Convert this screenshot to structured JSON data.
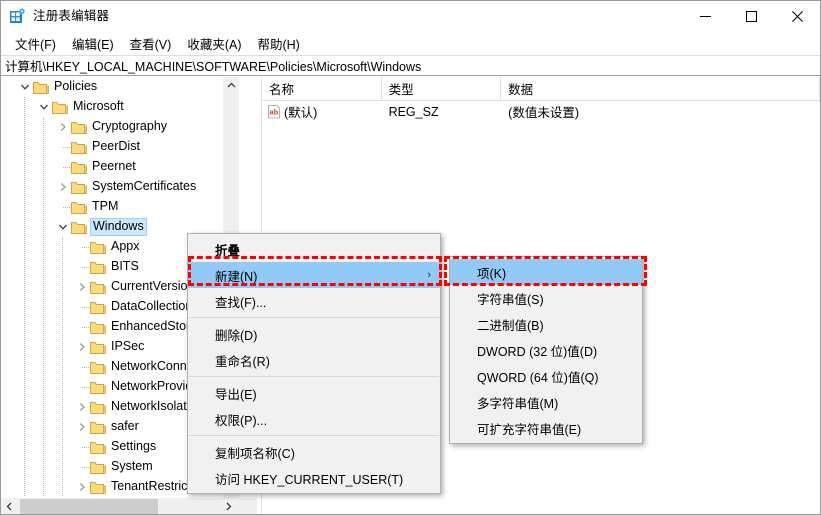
{
  "window": {
    "title": "注册表编辑器",
    "icon": "registry-editor-icon",
    "minimize": "—",
    "maximize": "□",
    "close": "✕"
  },
  "menubar": {
    "items": [
      {
        "label": "文件(F)",
        "name": "menu-file"
      },
      {
        "label": "编辑(E)",
        "name": "menu-edit"
      },
      {
        "label": "查看(V)",
        "name": "menu-view"
      },
      {
        "label": "收藏夹(A)",
        "name": "menu-favorites"
      },
      {
        "label": "帮助(H)",
        "name": "menu-help"
      }
    ]
  },
  "address": {
    "path": "计算机\\HKEY_LOCAL_MACHINE\\SOFTWARE\\Policies\\Microsoft\\Windows"
  },
  "tree": {
    "items": [
      {
        "label": "Policies",
        "depth": 1,
        "twisty": "expanded",
        "selected": false
      },
      {
        "label": "Microsoft",
        "depth": 2,
        "twisty": "expanded",
        "selected": false
      },
      {
        "label": "Cryptography",
        "depth": 3,
        "twisty": "collapsed",
        "selected": false
      },
      {
        "label": "PeerDist",
        "depth": 3,
        "twisty": "none",
        "selected": false
      },
      {
        "label": "Peernet",
        "depth": 3,
        "twisty": "none",
        "selected": false
      },
      {
        "label": "SystemCertificates",
        "depth": 3,
        "twisty": "collapsed",
        "selected": false
      },
      {
        "label": "TPM",
        "depth": 3,
        "twisty": "none",
        "selected": false
      },
      {
        "label": "Windows",
        "depth": 3,
        "twisty": "expanded",
        "selected": true
      },
      {
        "label": "Appx",
        "depth": 4,
        "twisty": "none",
        "selected": false
      },
      {
        "label": "BITS",
        "depth": 4,
        "twisty": "none",
        "selected": false
      },
      {
        "label": "CurrentVersion",
        "depth": 4,
        "twisty": "collapsed",
        "selected": false
      },
      {
        "label": "DataCollection",
        "depth": 4,
        "twisty": "none",
        "selected": false
      },
      {
        "label": "EnhancedStorageDevices",
        "depth": 4,
        "twisty": "none",
        "selected": false
      },
      {
        "label": "IPSec",
        "depth": 4,
        "twisty": "collapsed",
        "selected": false
      },
      {
        "label": "NetworkConnections",
        "depth": 4,
        "twisty": "none",
        "selected": false
      },
      {
        "label": "NetworkProvider",
        "depth": 4,
        "twisty": "none",
        "selected": false
      },
      {
        "label": "NetworkIsolation",
        "depth": 4,
        "twisty": "collapsed",
        "selected": false
      },
      {
        "label": "safer",
        "depth": 4,
        "twisty": "collapsed",
        "selected": false
      },
      {
        "label": "Settings",
        "depth": 4,
        "twisty": "none",
        "selected": false
      },
      {
        "label": "System",
        "depth": 4,
        "twisty": "none",
        "selected": false
      },
      {
        "label": "TenantRestrictions",
        "depth": 4,
        "twisty": "collapsed",
        "selected": false
      }
    ]
  },
  "list": {
    "columns": [
      {
        "label": "名称",
        "name": "column-name"
      },
      {
        "label": "类型",
        "name": "column-type"
      },
      {
        "label": "数据",
        "name": "column-data"
      }
    ],
    "rows": [
      {
        "icon": "string-value-icon",
        "name": "(默认)",
        "type": "REG_SZ",
        "data": "(数值未设置)"
      }
    ]
  },
  "context_menu": {
    "items": [
      {
        "label": "折叠",
        "name": "ctx-collapse",
        "bold": true,
        "highlight": false,
        "submenu": false,
        "separator_after": false
      },
      {
        "label": "新建(N)",
        "name": "ctx-new",
        "bold": false,
        "highlight": true,
        "submenu": true,
        "separator_after": false
      },
      {
        "label": "查找(F)...",
        "name": "ctx-find",
        "bold": false,
        "highlight": false,
        "submenu": false,
        "separator_after": true
      },
      {
        "label": "删除(D)",
        "name": "ctx-delete",
        "bold": false,
        "highlight": false,
        "submenu": false,
        "separator_after": false
      },
      {
        "label": "重命名(R)",
        "name": "ctx-rename",
        "bold": false,
        "highlight": false,
        "submenu": false,
        "separator_after": true
      },
      {
        "label": "导出(E)",
        "name": "ctx-export",
        "bold": false,
        "highlight": false,
        "submenu": false,
        "separator_after": false
      },
      {
        "label": "权限(P)...",
        "name": "ctx-permissions",
        "bold": false,
        "highlight": false,
        "submenu": false,
        "separator_after": true
      },
      {
        "label": "复制项名称(C)",
        "name": "ctx-copy-key-name",
        "bold": false,
        "highlight": false,
        "submenu": false,
        "separator_after": false
      },
      {
        "label": "访问 HKEY_CURRENT_USER(T)",
        "name": "ctx-goto-hkcu",
        "bold": false,
        "highlight": false,
        "submenu": false,
        "separator_after": false
      }
    ],
    "submenu_arrow": "›"
  },
  "submenu": {
    "items": [
      {
        "label": "项(K)",
        "name": "submenu-key",
        "highlight": true
      },
      {
        "label": "字符串值(S)",
        "name": "submenu-string-value",
        "highlight": false
      },
      {
        "label": "二进制值(B)",
        "name": "submenu-binary-value",
        "highlight": false
      },
      {
        "label": "DWORD (32 位)值(D)",
        "name": "submenu-dword-value",
        "highlight": false
      },
      {
        "label": "QWORD (64 位)值(Q)",
        "name": "submenu-qword-value",
        "highlight": false
      },
      {
        "label": "多字符串值(M)",
        "name": "submenu-multi-string",
        "highlight": false
      },
      {
        "label": "可扩充字符串值(E)",
        "name": "submenu-expandable-string",
        "highlight": false
      }
    ]
  },
  "colors": {
    "selection": "#cce8ff",
    "menu_highlight": "#91c9f7",
    "annotation": "#ff0000",
    "folder": "#ffda7a",
    "accent": "#0078d7"
  }
}
